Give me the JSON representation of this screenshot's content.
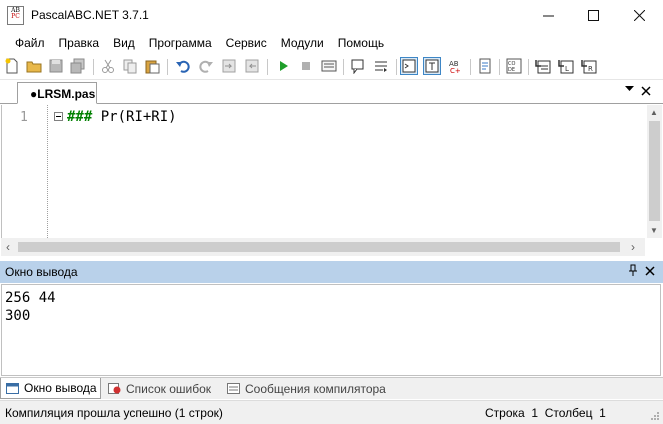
{
  "window": {
    "title": "PascalABC.NET 3.7.1",
    "icon_text_top": "AB",
    "icon_text_bottom": "PC"
  },
  "menu": [
    "Файл",
    "Правка",
    "Вид",
    "Программа",
    "Сервис",
    "Модули",
    "Помощь"
  ],
  "toolbar_icons": [
    "new-file-icon",
    "open-icon",
    "save-icon",
    "save-all-icon",
    "cut-icon",
    "copy-icon",
    "paste-icon",
    "undo-icon",
    "redo-icon",
    "indent-icon",
    "outdent-icon",
    "run-icon",
    "stop-icon",
    "debug-icon",
    "comment-icon",
    "uncomment-icon",
    "output-window-icon",
    "text-icon",
    "spellcheck-icon",
    "format-icon",
    "code-icon",
    "step-into-icon",
    "step-over-icon",
    "step-out-icon"
  ],
  "doc_tab": {
    "label": "●LRSM.pas"
  },
  "editor": {
    "line_number": "1",
    "code_hash": "###",
    "code_rest": " Pr(RI+RI)"
  },
  "output": {
    "title": "Окно вывода",
    "lines": [
      "256 44",
      "300"
    ]
  },
  "bottom_tabs": [
    "Окно вывода",
    "Список ошибок",
    "Сообщения компилятора"
  ],
  "status": {
    "message": "Компиляция прошла успешно (1 строк)",
    "row_label": "Строка",
    "row_value": "1",
    "col_label": "Столбец",
    "col_value": "1"
  },
  "colors": {
    "panel_header": "#b9d1ea",
    "selected_tool_border": "#3d86c6",
    "code_hash": "#008000"
  }
}
